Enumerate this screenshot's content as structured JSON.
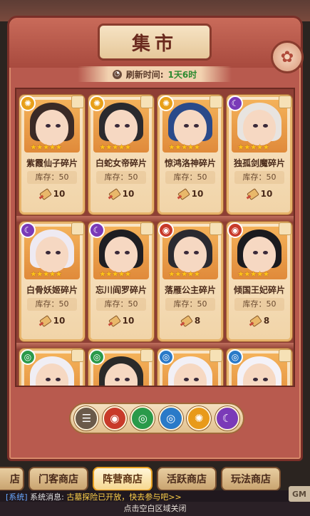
{
  "title": "集市",
  "refresh": {
    "label": "刷新时间:",
    "value": "1天6时"
  },
  "cards": [
    {
      "name": "紫霞仙子碎片",
      "stock": "库存：50",
      "price": "10",
      "faction": "sun",
      "stars": "★★★★★",
      "hair": "#3a2a26",
      "bg": "#f4b25a"
    },
    {
      "name": "白蛇女帝碎片",
      "stock": "库存：50",
      "price": "10",
      "faction": "sun",
      "stars": "★★★★★",
      "hair": "#2a2a2e",
      "bg": "#f4b25a"
    },
    {
      "name": "惊鸿洛神碎片",
      "stock": "库存：50",
      "price": "10",
      "faction": "sun",
      "stars": "★★★★★",
      "hair": "#2a4a8a",
      "bg": "#f4b25a"
    },
    {
      "name": "独孤剑魔碎片",
      "stock": "库存：50",
      "price": "10",
      "faction": "moon",
      "stars": "★★★★★",
      "hair": "#e8e4e0",
      "bg": "#f4b25a"
    },
    {
      "name": "白骨妖姬碎片",
      "stock": "库存：50",
      "price": "10",
      "faction": "moon",
      "stars": "★★★★★",
      "hair": "#eeeaf2",
      "bg": "#f4b25a"
    },
    {
      "name": "忘川阎罗碎片",
      "stock": "库存：50",
      "price": "10",
      "faction": "moon",
      "stars": "★★★★★",
      "hair": "#1e1e22",
      "bg": "#f4b25a"
    },
    {
      "name": "落雁公主碎片",
      "stock": "库存：50",
      "price": "8",
      "faction": "fire",
      "stars": "★★★★★",
      "hair": "#2a2a30",
      "bg": "#f4b25a"
    },
    {
      "name": "倾国王妃碎片",
      "stock": "库存：50",
      "price": "8",
      "faction": "fire",
      "stars": "★★★★★",
      "hair": "#1a1a1e",
      "bg": "#f4b25a"
    },
    {
      "name": "",
      "stock": "",
      "price": "",
      "faction": "wind",
      "stars": "",
      "hair": "#f0eef4",
      "bg": "#f4b25a"
    },
    {
      "name": "",
      "stock": "",
      "price": "",
      "faction": "wind",
      "stars": "",
      "hair": "#2a2a2a",
      "bg": "#f4b25a"
    },
    {
      "name": "",
      "stock": "",
      "price": "",
      "faction": "water",
      "stars": "",
      "hair": "#f2f0f6",
      "bg": "#f4b25a"
    },
    {
      "name": "",
      "stock": "",
      "price": "",
      "faction": "water",
      "stars": "",
      "hair": "#f4f2f8",
      "bg": "#f4b25a"
    }
  ],
  "filters": [
    {
      "icon": "list-icon",
      "color": "#6a5a4a",
      "glyph": "☰"
    },
    {
      "icon": "fire-faction-icon",
      "color": "#c83a2a",
      "glyph": "◉"
    },
    {
      "icon": "wind-faction-icon",
      "color": "#2a9a4a",
      "glyph": "◎"
    },
    {
      "icon": "water-faction-icon",
      "color": "#2a7ac8",
      "glyph": "◎"
    },
    {
      "icon": "sun-faction-icon",
      "color": "#e89a1a",
      "glyph": "✺"
    },
    {
      "icon": "moon-faction-icon",
      "color": "#7a3ab8",
      "glyph": "☾"
    }
  ],
  "tabs": [
    {
      "label": "店",
      "active": false
    },
    {
      "label": "门客商店",
      "active": false
    },
    {
      "label": "阵营商店",
      "active": true
    },
    {
      "label": "活跃商店",
      "active": false
    },
    {
      "label": "玩法商店",
      "active": false
    }
  ],
  "system_message": {
    "tag": "[系统]",
    "label": "系统消息:",
    "text": "古墓探险已开放，快去参与吧>>"
  },
  "gm_label": "GM",
  "close_hint": "点击空白区域关闭",
  "faction_colors": {
    "sun": "#e8a01a",
    "moon": "#7a3ab8",
    "fire": "#c83a2a",
    "wind": "#2a9a4a",
    "water": "#2a7ac8"
  },
  "faction_glyphs": {
    "sun": "✺",
    "moon": "☾",
    "fire": "◉",
    "wind": "◎",
    "water": "◎"
  }
}
